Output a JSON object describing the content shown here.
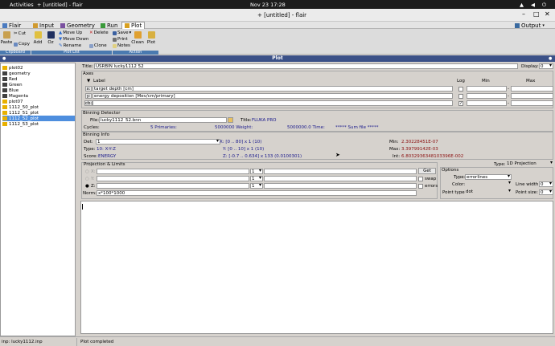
{
  "topbar": {
    "activities": "Activities",
    "app": "+ [untitled] - flair",
    "clock": "Nov 23  17:28"
  },
  "window": {
    "title": "+ [untitled] - flair"
  },
  "tabs": [
    {
      "label": "Flair"
    },
    {
      "label": "Input"
    },
    {
      "label": "Geometry"
    },
    {
      "label": "Run"
    },
    {
      "label": "Plot"
    }
  ],
  "output_tab": "Output",
  "ribbon": {
    "paste": "Paste",
    "cut": "Cut",
    "copy": "Copy",
    "add": "Add",
    "oz": "Oz",
    "move_up": "Move Up",
    "move_down": "Move Down",
    "rename": "Rename",
    "delete": "Delete",
    "clone": "Clone",
    "save": "Save",
    "print": "Print",
    "notes": "Notes",
    "clean": "Clean",
    "plot": "Plot",
    "groups": [
      "Clipboard",
      "Plot List",
      "Action"
    ]
  },
  "plot_header": "Plot",
  "tree": [
    "plot02",
    "geometry",
    "Red",
    "Green",
    "Blue",
    "Magenta",
    "plot07",
    "1112_50_plot",
    "1112_51_plot",
    "1112_52_plot",
    "1112_53_plot"
  ],
  "tree_selected": 9,
  "form": {
    "title_label": "Title:",
    "title_value": "USRBIN lucky1112 52",
    "display_label": "Display:",
    "display_value": "0",
    "axes_header": "Axes",
    "axes_cols": {
      "label": "Label",
      "log": "Log",
      "min": "Min",
      "max": "Max"
    },
    "axes_rows": [
      {
        "axis": "x:",
        "label": "target depth [cm]"
      },
      {
        "axis": "y:",
        "label": "energy deposition [Mev/cm/primary]"
      },
      {
        "axis": "cb:",
        "label": ""
      }
    ],
    "binning_detector": "Binning Detector",
    "file_label": "File:",
    "file_value": "lucky1112_52.bnn",
    "file_title_label": "Title:",
    "file_title_value": "FLUKA PRO",
    "cycles_label": "Cycles:",
    "cycles_value": "5 Primaries:",
    "primaries_value": "5000000 Weight:",
    "weight_value": "5000000.0 Time:",
    "time_value": "***** Sum file *****",
    "binning_info": "Binning Info",
    "det_label": "Det:",
    "det_value": "1",
    "x_range": "X: [0 .. 80] x 1 (10)",
    "min_label": "Min:",
    "min_value": "2.30228451E-07",
    "type_label": "Type:",
    "type_value": "10: X-Y-Z",
    "y_range": "Y: [0 .. 10] x 1 (10)",
    "max_label": "Max:",
    "max_value": "3.39799142E-03",
    "score_label": "Score:",
    "score_value": "ENERGY",
    "z_range": "Z: [-0.7 .. 0.634] x 133 (0.0100301)",
    "int_label": "Int:",
    "int_value": "6.8032936348103396E-002",
    "proj_header": "Projection & Limits",
    "proj_type_label": "Type:",
    "proj_type_value": "1D Projection",
    "proj_rows": [
      {
        "axis": "X:",
        "n": "1"
      },
      {
        "axis": "Y:",
        "n": "1"
      },
      {
        "axis": "Z:",
        "n": "1"
      }
    ],
    "get_btn": "Get",
    "swap": "swap",
    "errors": "errors",
    "norm_label": "Norm:",
    "norm_value": "x*100*1000",
    "options_header": "Options",
    "opt_type_label": "Type:",
    "opt_type_value": "errorlines",
    "color_label": "Color:",
    "color_value": "",
    "point_type_label": "Point type:",
    "point_type_value": "dot",
    "line_width_label": "Line width:",
    "line_width_value": "0",
    "point_size_label": "Point size:",
    "point_size_value": "0"
  },
  "status": {
    "left": "inp: lucky1112.inp",
    "right": "Plot completed"
  }
}
